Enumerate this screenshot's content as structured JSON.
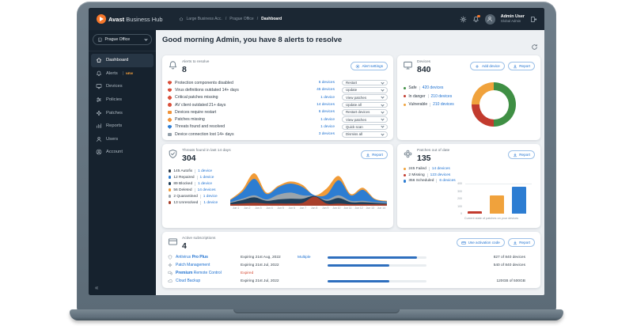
{
  "colors": {
    "accent_blue": "#1b6fd0",
    "brand_orange": "#f6772b",
    "header_bg": "#1b2733",
    "sidebar_bg": "#16222e",
    "expired_red": "#d64b33"
  },
  "header": {
    "brand_bold": "Avast",
    "brand_rest": " Business Hub",
    "breadcrumb": {
      "root": "Large Business Acc.",
      "sep": "/",
      "middle": "Prague Office",
      "current": "Dashboard"
    },
    "user_name": "Admin User",
    "user_role": "Global Admin"
  },
  "sidebar": {
    "org_selector": "Prague Office",
    "collapse_glyph": "«",
    "items": [
      {
        "label": "Dashboard"
      },
      {
        "label": "Alerts",
        "badge": "NEW"
      },
      {
        "label": "Devices"
      },
      {
        "label": "Policies"
      },
      {
        "label": "Patches"
      },
      {
        "label": "Reports"
      },
      {
        "label": "Users"
      },
      {
        "label": "Account"
      }
    ]
  },
  "main": {
    "greeting": "Good morning Admin, you have 8 alerts to resolve"
  },
  "alerts_card": {
    "title": "Alerts to resolve",
    "count": "8",
    "settings_button": "Alert settings",
    "rows": [
      {
        "label": "Protection components disabled",
        "devices": "6 devices",
        "action": "Restart"
      },
      {
        "label": "Virus definitions outdated 14+ days",
        "devices": "45 devices",
        "action": "Update"
      },
      {
        "label": "Critical patches missing",
        "devices": "1 device",
        "action": "View patches"
      },
      {
        "label": "AV client outdated 21+ days",
        "devices": "14 devices",
        "action": "Update all"
      },
      {
        "label": "Devices require restart",
        "devices": "6 devices",
        "action": "Restart devices"
      },
      {
        "label": "Patches missing",
        "devices": "1 device",
        "action": "View patches"
      },
      {
        "label": "Threats found and resolved",
        "devices": "1 device",
        "action": "Quick scan"
      },
      {
        "label": "Device connection lost 14+ days",
        "devices": "3 devices",
        "action": "Dismiss all"
      }
    ]
  },
  "devices_card": {
    "title": "Devices",
    "count": "840",
    "add_button": "Add device",
    "report_button": "Report",
    "legend": [
      {
        "label": "Safe",
        "devices": "420 devices",
        "color": "#3f8f44"
      },
      {
        "label": "In danger",
        "devices": "210 devices",
        "color": "#c23b2e"
      },
      {
        "label": "Vulnerable",
        "devices": "210 devices",
        "color": "#f0a23c"
      }
    ]
  },
  "threats_card": {
    "title": "Threats found in last 14 days",
    "count": "304",
    "report_button": "Report",
    "legend": [
      {
        "count_label": "145 Autofix",
        "devices": "1 device",
        "color": "#2b3845"
      },
      {
        "count_label": "12 Repaired",
        "devices": "1 device",
        "color": "#2d7dd2"
      },
      {
        "count_label": "89 Blocked",
        "devices": "1 device",
        "color": "#1e3d59"
      },
      {
        "count_label": "56 Deleted",
        "devices": "14 devices",
        "color": "#f19b37"
      },
      {
        "count_label": "2 Quarantined",
        "devices": "1 device",
        "color": "#9aa4ac"
      },
      {
        "count_label": "13 Unresolved",
        "devices": "1 device",
        "color": "#a8402c"
      }
    ]
  },
  "patches_card": {
    "title": "Patches out of date",
    "count": "135",
    "report_button": "Report",
    "legend": [
      {
        "count_label": "245 Failed",
        "devices": "14 devices",
        "color": "#f0a23c"
      },
      {
        "count_label": "2 Missing",
        "devices": "123 devices",
        "color": "#c23b2e"
      },
      {
        "count_label": "356 Scheduled",
        "devices": "6 devices",
        "color": "#2d7dd2"
      }
    ]
  },
  "subs_card": {
    "title": "Active subscriptions",
    "count": "4",
    "activation_button": "Use activation code",
    "report_button": "Report",
    "rows": [
      {
        "name_pre": "Antivirus ",
        "name_bold": "Pro Plus",
        "name_post": "",
        "expiry": "Expiring 21st Aug, 2022",
        "extra": "Multiple",
        "progress_pct": 90,
        "usage": "827 of 840 devices"
      },
      {
        "name_pre": "",
        "name_bold": "",
        "name_post": "Patch Management",
        "expiry": "Expiring 21st Jul, 2022",
        "extra": "",
        "progress_pct": 62,
        "usage": "540 of 840 devices"
      },
      {
        "name_pre": "",
        "name_bold": "Premium",
        "name_post": " Remote Control",
        "expiry": "Expired",
        "extra": "",
        "progress_pct": null,
        "usage": ""
      },
      {
        "name_pre": "",
        "name_bold": "",
        "name_post": "Cloud Backup",
        "expiry": "Expiring 21st Jul, 2022",
        "extra": "",
        "progress_pct": 62,
        "usage": "120GB of 500GB"
      }
    ]
  },
  "chart_data": [
    {
      "id": "devices_donut",
      "type": "pie",
      "title": "Devices by status",
      "labels": [
        "Safe",
        "In danger",
        "Vulnerable"
      ],
      "values": [
        420,
        210,
        210
      ],
      "colors": [
        "#3f8f44",
        "#c23b2e",
        "#f0a23c"
      ],
      "donut": true
    },
    {
      "id": "threats_area",
      "type": "area",
      "title": "Threats found in last 14 days",
      "stacked": true,
      "x": [
        "Jun 1",
        "Jun 2",
        "Jun 3",
        "Jun 4",
        "Jun 5",
        "Jun 6",
        "Jun 7",
        "Jun 8",
        "Jun 9",
        "Jun 10",
        "Jun 11",
        "Jun 12",
        "Jun 13",
        "Jun 14"
      ],
      "series": [
        {
          "name": "Unresolved",
          "color": "#a8402c",
          "values": [
            1,
            2,
            3,
            2,
            2,
            2,
            3,
            12,
            2,
            2,
            1,
            1,
            1,
            1
          ]
        },
        {
          "name": "Blocked",
          "color": "#1e3d59",
          "values": [
            2,
            5,
            8,
            4,
            6,
            7,
            6,
            1,
            4,
            8,
            3,
            3,
            2,
            1
          ]
        },
        {
          "name": "Quarantined",
          "color": "#9aa4ac",
          "values": [
            1,
            2,
            3,
            2,
            7,
            9,
            5,
            0,
            2,
            4,
            2,
            2,
            1,
            1
          ]
        },
        {
          "name": "Autofix",
          "color": "#2d7dd2",
          "values": [
            3,
            10,
            24,
            8,
            11,
            13,
            12,
            1,
            7,
            22,
            8,
            16,
            4,
            2
          ]
        },
        {
          "name": "Deleted",
          "color": "#f19b37",
          "values": [
            1,
            3,
            8,
            2,
            2,
            3,
            3,
            0,
            9,
            6,
            2,
            3,
            1,
            1
          ]
        }
      ]
    },
    {
      "id": "patches_bar",
      "type": "bar",
      "categories": [
        "Missing",
        "Failed",
        "Scheduled"
      ],
      "values": [
        2,
        245,
        356
      ],
      "colors": [
        "#c23b2e",
        "#f0a23c",
        "#2d7dd2"
      ],
      "ylim": [
        0,
        400
      ],
      "yticks": [
        0,
        100,
        200,
        300,
        400
      ],
      "xlabel": "Current state of patches on your devices"
    }
  ]
}
